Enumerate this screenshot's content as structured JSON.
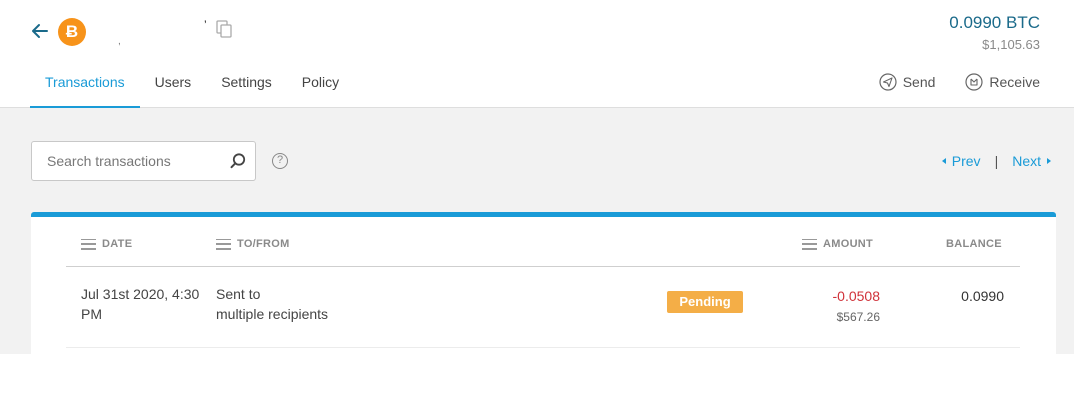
{
  "header": {
    "wallet_mark_1": "’",
    "wallet_mark_2": ",",
    "coin_symbol": "Ƀ",
    "balance_btc": "0.0990 BTC",
    "balance_usd": "$1,105.63"
  },
  "tabs": [
    {
      "label": "Transactions",
      "active": true
    },
    {
      "label": "Users",
      "active": false
    },
    {
      "label": "Settings",
      "active": false
    },
    {
      "label": "Policy",
      "active": false
    }
  ],
  "actions": {
    "send_label": "Send",
    "receive_label": "Receive"
  },
  "search": {
    "placeholder": "Search transactions",
    "value": ""
  },
  "help_glyph": "?",
  "pager": {
    "prev_label": "Prev",
    "separator": "|",
    "next_label": "Next"
  },
  "table": {
    "columns": {
      "date": "DATE",
      "to_from": "TO/FROM",
      "amount": "AMOUNT",
      "balance": "BALANCE"
    },
    "rows": [
      {
        "date_line1": "Jul 31st 2020, 4:30",
        "date_line2": "PM",
        "to_from_line1": "Sent to",
        "to_from_line2": "multiple recipients",
        "status": "Pending",
        "amount": "-0.0508",
        "amount_usd": "$567.26",
        "balance": "0.0990"
      }
    ]
  },
  "colors": {
    "accent": "#1a9bd7",
    "bitcoin": "#f7931a",
    "pending": "#f4ae47",
    "negative": "#d0323a",
    "balance_text": "#1a6a8a"
  }
}
